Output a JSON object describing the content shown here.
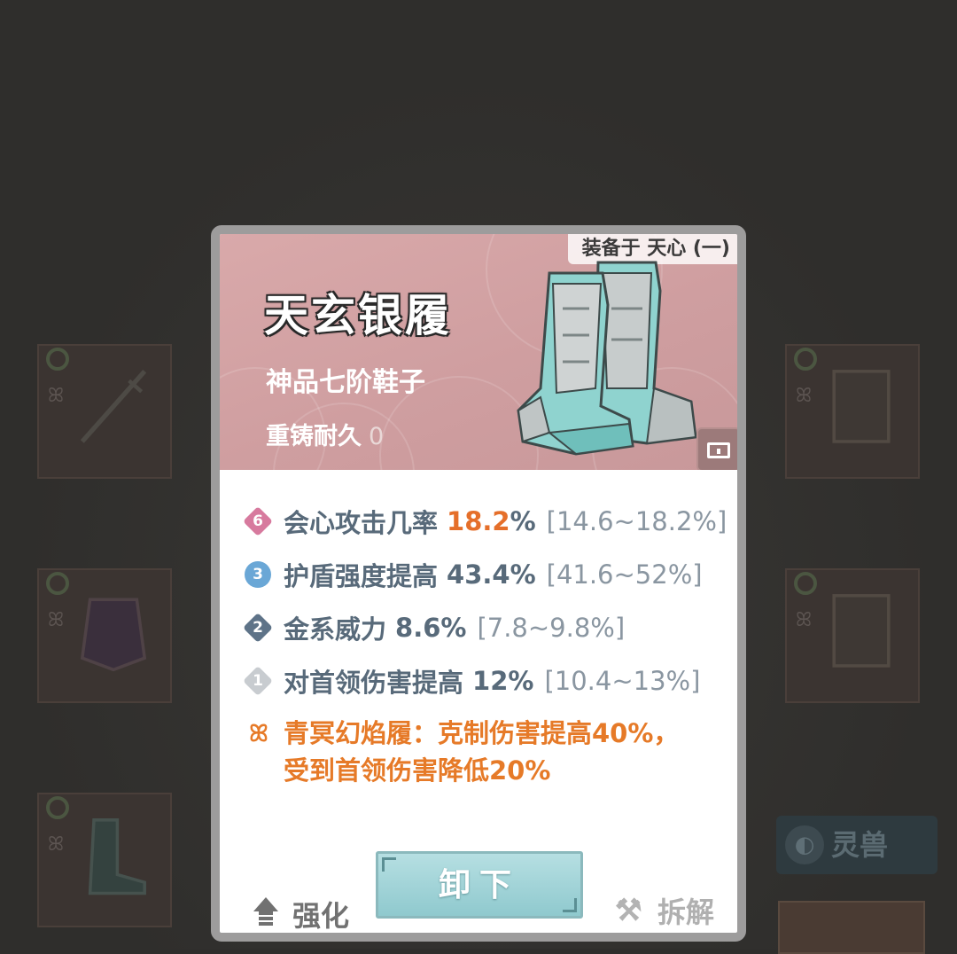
{
  "equip_panel": {
    "equipped_label": "装备于 天心 (一)",
    "item_name": "天玄银履",
    "item_grade": "神品七阶鞋子",
    "recast_label": "重铸耐久",
    "recast_value": "0",
    "stats": [
      {
        "tier": "6",
        "tier_color": "#d77a9e",
        "name": "会心攻击几率",
        "value": "18.2",
        "unit": "%",
        "range": "[14.6~18.2%]",
        "highlight": true
      },
      {
        "tier": "3",
        "tier_color": "#6aa7d6",
        "name": "护盾强度提高",
        "value": "43.4%",
        "unit": "",
        "range": "[41.6~52%]",
        "highlight": false
      },
      {
        "tier": "2",
        "tier_color": "#5e7388",
        "name": "金系威力",
        "value": "8.6%",
        "unit": "",
        "range": "[7.8~9.8%]",
        "highlight": false
      },
      {
        "tier": "1",
        "tier_color": "#c8ccd0",
        "name": "对首领伤害提高",
        "value": "12%",
        "unit": "",
        "range": "[10.4~13%]",
        "highlight": false
      }
    ],
    "set_effect_line1": "青冥幻焰履：克制伤害提高40%，",
    "set_effect_line2": "受到首领伤害降低20%",
    "enhance_label": "强化",
    "unequip_label": "卸下",
    "disassemble_label": "拆解"
  },
  "background": {
    "beast_button_label": "灵兽"
  },
  "colors": {
    "header_bg": "#d3a2a4",
    "highlight_value": "#e56f2a",
    "set_effect": "#e67a28",
    "unequip_button": "#a4d4d8"
  }
}
